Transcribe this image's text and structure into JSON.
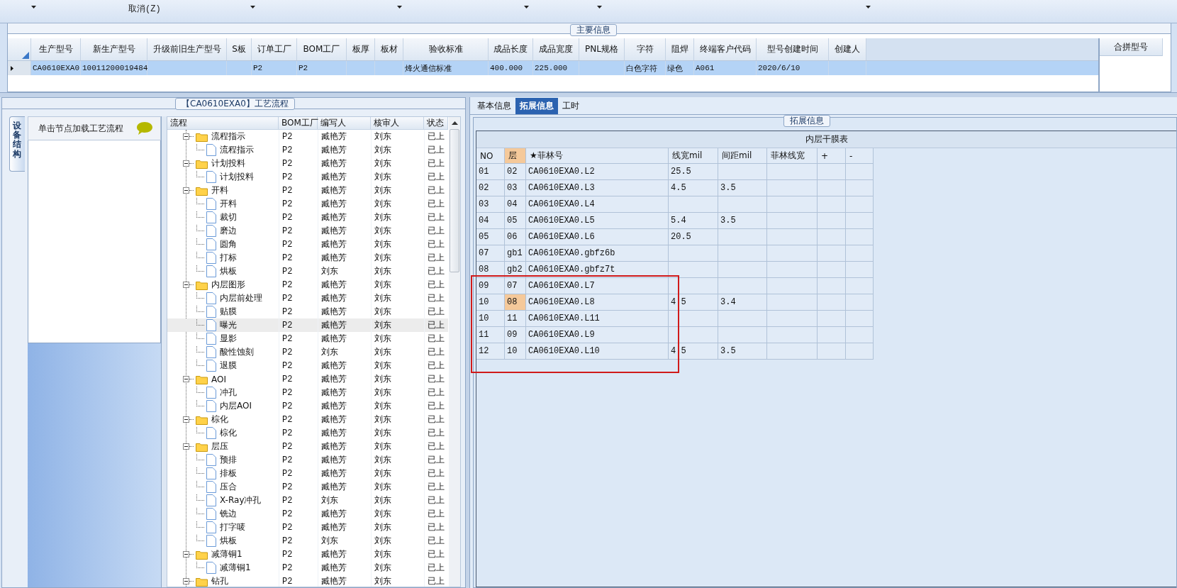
{
  "toolbar": {
    "items": [
      {
        "kind": "dropdown"
      },
      {
        "kind": "button",
        "label": "取消(Z)"
      },
      {
        "kind": "dropdown"
      },
      {
        "kind": "dropdown"
      },
      {
        "kind": "dropdown"
      },
      {
        "kind": "dropdown"
      },
      {
        "kind": "dropdown"
      }
    ]
  },
  "main_info": {
    "title": "主要信息",
    "columns": [
      "生产型号",
      "新生产型号",
      "升级前旧生产型号",
      "S板",
      "订单工厂",
      "BOM工厂",
      "板厚",
      "板材",
      "验收标准",
      "成品长度",
      "成品宽度",
      "PNL规格",
      "字符",
      "阻焊",
      "终端客户代码",
      "型号创建时间",
      "创建人"
    ],
    "rows": [
      {
        "selected": true,
        "cells": [
          "CA0610EXA0",
          "10011200019484",
          null,
          null,
          "P2",
          "P2",
          null,
          null,
          "烽火通信标准",
          "400.000",
          "225.000",
          null,
          "白色字符",
          "绿色",
          "A061",
          "2020/6/10",
          null
        ]
      }
    ],
    "merge_panel": {
      "title": "合拼型号"
    }
  },
  "process": {
    "title": "【CA0610EXA0】工艺流程",
    "side_tab": {
      "label": "设备结构",
      "selected": true
    },
    "hint": "单击节点加载工艺流程",
    "columns": [
      "流程",
      "BOM工厂",
      "编写人",
      "核审人",
      "状态"
    ],
    "tree": [
      {
        "kind": "folder",
        "label": "流程指示",
        "bom": "P2",
        "author": "臧艳芳",
        "reviewer": "刘东",
        "status": "已上",
        "expanded": true,
        "selected": false,
        "children": [
          {
            "kind": "file",
            "label": "流程指示",
            "bom": "P2",
            "author": "臧艳芳",
            "reviewer": "刘东",
            "status": "已上",
            "selected": false
          }
        ]
      },
      {
        "kind": "folder",
        "label": "计划投料",
        "bom": "P2",
        "author": "臧艳芳",
        "reviewer": "刘东",
        "status": "已上",
        "expanded": true,
        "selected": false,
        "children": [
          {
            "kind": "file",
            "label": "计划投料",
            "bom": "P2",
            "author": "臧艳芳",
            "reviewer": "刘东",
            "status": "已上",
            "selected": false
          }
        ]
      },
      {
        "kind": "folder",
        "label": "开料",
        "bom": "P2",
        "author": "臧艳芳",
        "reviewer": "刘东",
        "status": "已上",
        "expanded": true,
        "selected": false,
        "children": [
          {
            "kind": "file",
            "label": "开料",
            "bom": "P2",
            "author": "臧艳芳",
            "reviewer": "刘东",
            "status": "已上",
            "selected": false
          },
          {
            "kind": "file",
            "label": "裁切",
            "bom": "P2",
            "author": "臧艳芳",
            "reviewer": "刘东",
            "status": "已上",
            "selected": false
          },
          {
            "kind": "file",
            "label": "磨边",
            "bom": "P2",
            "author": "臧艳芳",
            "reviewer": "刘东",
            "status": "已上",
            "selected": false
          },
          {
            "kind": "file",
            "label": "圆角",
            "bom": "P2",
            "author": "臧艳芳",
            "reviewer": "刘东",
            "status": "已上",
            "selected": false
          },
          {
            "kind": "file",
            "label": "打标",
            "bom": "P2",
            "author": "臧艳芳",
            "reviewer": "刘东",
            "status": "已上",
            "selected": false
          },
          {
            "kind": "file",
            "label": "烘板",
            "bom": "P2",
            "author": "刘东",
            "reviewer": "刘东",
            "status": "已上",
            "selected": false
          }
        ]
      },
      {
        "kind": "folder",
        "label": "内层图形",
        "bom": "P2",
        "author": "臧艳芳",
        "reviewer": "刘东",
        "status": "已上",
        "expanded": true,
        "selected": false,
        "children": [
          {
            "kind": "file",
            "label": "内层前处理",
            "bom": "P2",
            "author": "臧艳芳",
            "reviewer": "刘东",
            "status": "已上",
            "selected": false
          },
          {
            "kind": "file",
            "label": "贴膜",
            "bom": "P2",
            "author": "臧艳芳",
            "reviewer": "刘东",
            "status": "已上",
            "selected": false
          },
          {
            "kind": "file",
            "label": "曝光",
            "bom": "P2",
            "author": "臧艳芳",
            "reviewer": "刘东",
            "status": "已上",
            "selected": true
          },
          {
            "kind": "file",
            "label": "显影",
            "bom": "P2",
            "author": "臧艳芳",
            "reviewer": "刘东",
            "status": "已上",
            "selected": false
          },
          {
            "kind": "file",
            "label": "酸性蚀刻",
            "bom": "P2",
            "author": "刘东",
            "reviewer": "刘东",
            "status": "已上",
            "selected": false
          },
          {
            "kind": "file",
            "label": "退膜",
            "bom": "P2",
            "author": "臧艳芳",
            "reviewer": "刘东",
            "status": "已上",
            "selected": false
          }
        ]
      },
      {
        "kind": "folder",
        "label": "AOI",
        "bom": "P2",
        "author": "臧艳芳",
        "reviewer": "刘东",
        "status": "已上",
        "expanded": true,
        "selected": false,
        "children": [
          {
            "kind": "file",
            "label": "冲孔",
            "bom": "P2",
            "author": "臧艳芳",
            "reviewer": "刘东",
            "status": "已上",
            "selected": false
          },
          {
            "kind": "file",
            "label": "内层AOI",
            "bom": "P2",
            "author": "臧艳芳",
            "reviewer": "刘东",
            "status": "已上",
            "selected": false
          }
        ]
      },
      {
        "kind": "folder",
        "label": "棕化",
        "bom": "P2",
        "author": "臧艳芳",
        "reviewer": "刘东",
        "status": "已上",
        "expanded": true,
        "selected": false,
        "children": [
          {
            "kind": "file",
            "label": "棕化",
            "bom": "P2",
            "author": "臧艳芳",
            "reviewer": "刘东",
            "status": "已上",
            "selected": false
          }
        ]
      },
      {
        "kind": "folder",
        "label": "层压",
        "bom": "P2",
        "author": "臧艳芳",
        "reviewer": "刘东",
        "status": "已上",
        "expanded": true,
        "selected": false,
        "children": [
          {
            "kind": "file",
            "label": "预排",
            "bom": "P2",
            "author": "臧艳芳",
            "reviewer": "刘东",
            "status": "已上",
            "selected": false
          },
          {
            "kind": "file",
            "label": "排板",
            "bom": "P2",
            "author": "臧艳芳",
            "reviewer": "刘东",
            "status": "已上",
            "selected": false
          },
          {
            "kind": "file",
            "label": "压合",
            "bom": "P2",
            "author": "臧艳芳",
            "reviewer": "刘东",
            "status": "已上",
            "selected": false
          },
          {
            "kind": "file",
            "label": "X-Ray冲孔",
            "bom": "P2",
            "author": "刘东",
            "reviewer": "刘东",
            "status": "已上",
            "selected": false
          },
          {
            "kind": "file",
            "label": "铣边",
            "bom": "P2",
            "author": "臧艳芳",
            "reviewer": "刘东",
            "status": "已上",
            "selected": false
          },
          {
            "kind": "file",
            "label": "打字唛",
            "bom": "P2",
            "author": "臧艳芳",
            "reviewer": "刘东",
            "status": "已上",
            "selected": false
          },
          {
            "kind": "file",
            "label": "烘板",
            "bom": "P2",
            "author": "刘东",
            "reviewer": "刘东",
            "status": "已上",
            "selected": false
          }
        ]
      },
      {
        "kind": "folder",
        "label": "减薄铜1",
        "bom": "P2",
        "author": "臧艳芳",
        "reviewer": "刘东",
        "status": "已上",
        "expanded": true,
        "selected": false,
        "children": [
          {
            "kind": "file",
            "label": "减薄铜1",
            "bom": "P2",
            "author": "臧艳芳",
            "reviewer": "刘东",
            "status": "已上",
            "selected": false
          }
        ]
      },
      {
        "kind": "folder",
        "label": "钻孔",
        "bom": "P2",
        "author": "臧艳芳",
        "reviewer": "刘东",
        "status": "已上",
        "expanded": true,
        "selected": false
      }
    ]
  },
  "detail": {
    "tabs": [
      {
        "label": "基本信息",
        "selected": false
      },
      {
        "label": "拓展信息",
        "selected": true
      },
      {
        "label": "工时",
        "selected": false
      }
    ],
    "group_title": "拓展信息",
    "table": {
      "title": "内层干膜表",
      "columns": [
        {
          "label": "NO",
          "selected": false
        },
        {
          "label": "层",
          "selected": true
        },
        {
          "label": "★菲林号",
          "selected": false
        },
        {
          "label": "线宽mil",
          "selected": false
        },
        {
          "label": "间距mil",
          "selected": false
        },
        {
          "label": "菲林线宽",
          "selected": false
        },
        {
          "label": "+",
          "selected": false
        },
        {
          "label": "-",
          "selected": false
        }
      ],
      "rows": [
        {
          "focused": false,
          "cells": [
            "01",
            "02",
            "CA0610EXA0.L2",
            "25.5",
            null,
            null,
            null,
            null
          ]
        },
        {
          "focused": false,
          "cells": [
            "02",
            "03",
            "CA0610EXA0.L3",
            "4.5",
            "3.5",
            null,
            null,
            null
          ]
        },
        {
          "focused": false,
          "cells": [
            "03",
            "04",
            "CA0610EXA0.L4",
            null,
            null,
            null,
            null,
            null
          ]
        },
        {
          "focused": false,
          "cells": [
            "04",
            "05",
            "CA0610EXA0.L5",
            "5.4",
            "3.5",
            null,
            null,
            null
          ]
        },
        {
          "focused": false,
          "cells": [
            "05",
            "06",
            "CA0610EXA0.L6",
            "20.5",
            null,
            null,
            null,
            null
          ]
        },
        {
          "focused": false,
          "cells": [
            "07",
            "gb1",
            "CA0610EXA0.gbfz6b",
            null,
            null,
            null,
            null,
            null
          ]
        },
        {
          "focused": false,
          "cells": [
            "08",
            "gb2",
            "CA0610EXA0.gbfz7t",
            null,
            null,
            null,
            null,
            null
          ]
        },
        {
          "focused": false,
          "cells": [
            "09",
            "07",
            "CA0610EXA0.L7",
            null,
            null,
            null,
            null,
            null
          ]
        },
        {
          "focused": true,
          "cells": [
            "10",
            "08",
            "CA0610EXA0.L8",
            "4.5",
            "3.4",
            null,
            null,
            null
          ]
        },
        {
          "focused": false,
          "cells": [
            "10",
            "11",
            "CA0610EXA0.L11",
            null,
            null,
            null,
            null,
            null
          ]
        },
        {
          "focused": false,
          "cells": [
            "11",
            "09",
            "CA0610EXA0.L9",
            null,
            null,
            null,
            null,
            null
          ]
        },
        {
          "focused": false,
          "cells": [
            "12",
            "10",
            "CA0610EXA0.L10",
            "4.5",
            "3.5",
            null,
            null,
            null
          ]
        }
      ]
    }
  }
}
